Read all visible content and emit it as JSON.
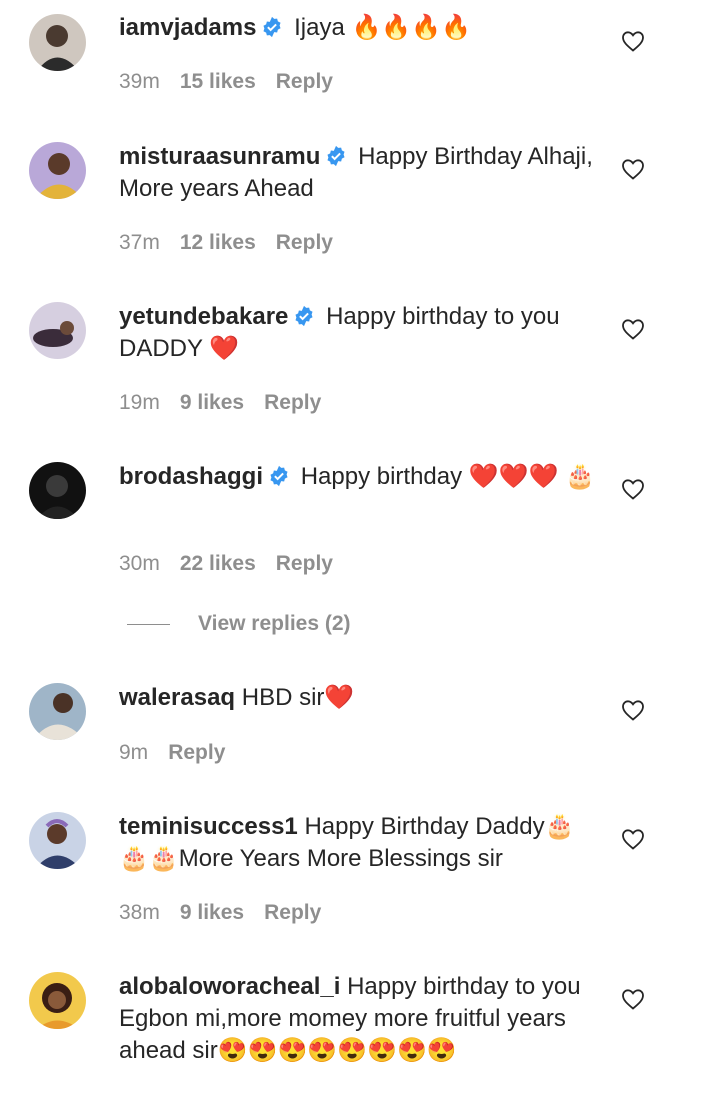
{
  "colors": {
    "text": "#262626",
    "meta": "#8e8e8e",
    "verified": "#3897f0",
    "heart_emoji": "#dd2e44"
  },
  "comments": [
    {
      "username": "iamvjadams",
      "verified": true,
      "text": "Ijaya 🔥🔥🔥🔥",
      "time": "39m",
      "likes": "15 likes",
      "reply": "Reply"
    },
    {
      "username": "misturaasunramu",
      "verified": true,
      "text": "Happy Birthday Alhaji, More years Ahead",
      "time": "37m",
      "likes": "12 likes",
      "reply": "Reply"
    },
    {
      "username": "yetundebakare",
      "verified": true,
      "text": "Happy birthday to you DADDY ❤️",
      "time": "19m",
      "likes": "9 likes",
      "reply": "Reply"
    },
    {
      "username": "brodashaggi",
      "verified": true,
      "text": "Happy birthday ❤️❤️❤️ 🎂",
      "time": "30m",
      "likes": "22 likes",
      "reply": "Reply"
    },
    {
      "username": "walerasaq",
      "verified": false,
      "text": "HBD sir❤️",
      "time": "9m",
      "likes": "",
      "reply": "Reply"
    },
    {
      "username": "teminisuccess1",
      "verified": false,
      "text": "Happy Birthday Daddy🎂 🎂🎂More Years More Blessings sir",
      "time": "38m",
      "likes": "9 likes",
      "reply": "Reply"
    },
    {
      "username": "alobaloworacheal_i",
      "verified": false,
      "text": "Happy birthday to you Egbon mi,more momey more fruitful years ahead sir😍😍😍😍😍😍😍😍",
      "time": "",
      "likes": "",
      "reply": ""
    }
  ],
  "view_replies": "View replies (2)",
  "icons": {
    "verified": "verified-badge-icon",
    "like": "heart-outline-icon",
    "avatar": "user-avatar"
  }
}
